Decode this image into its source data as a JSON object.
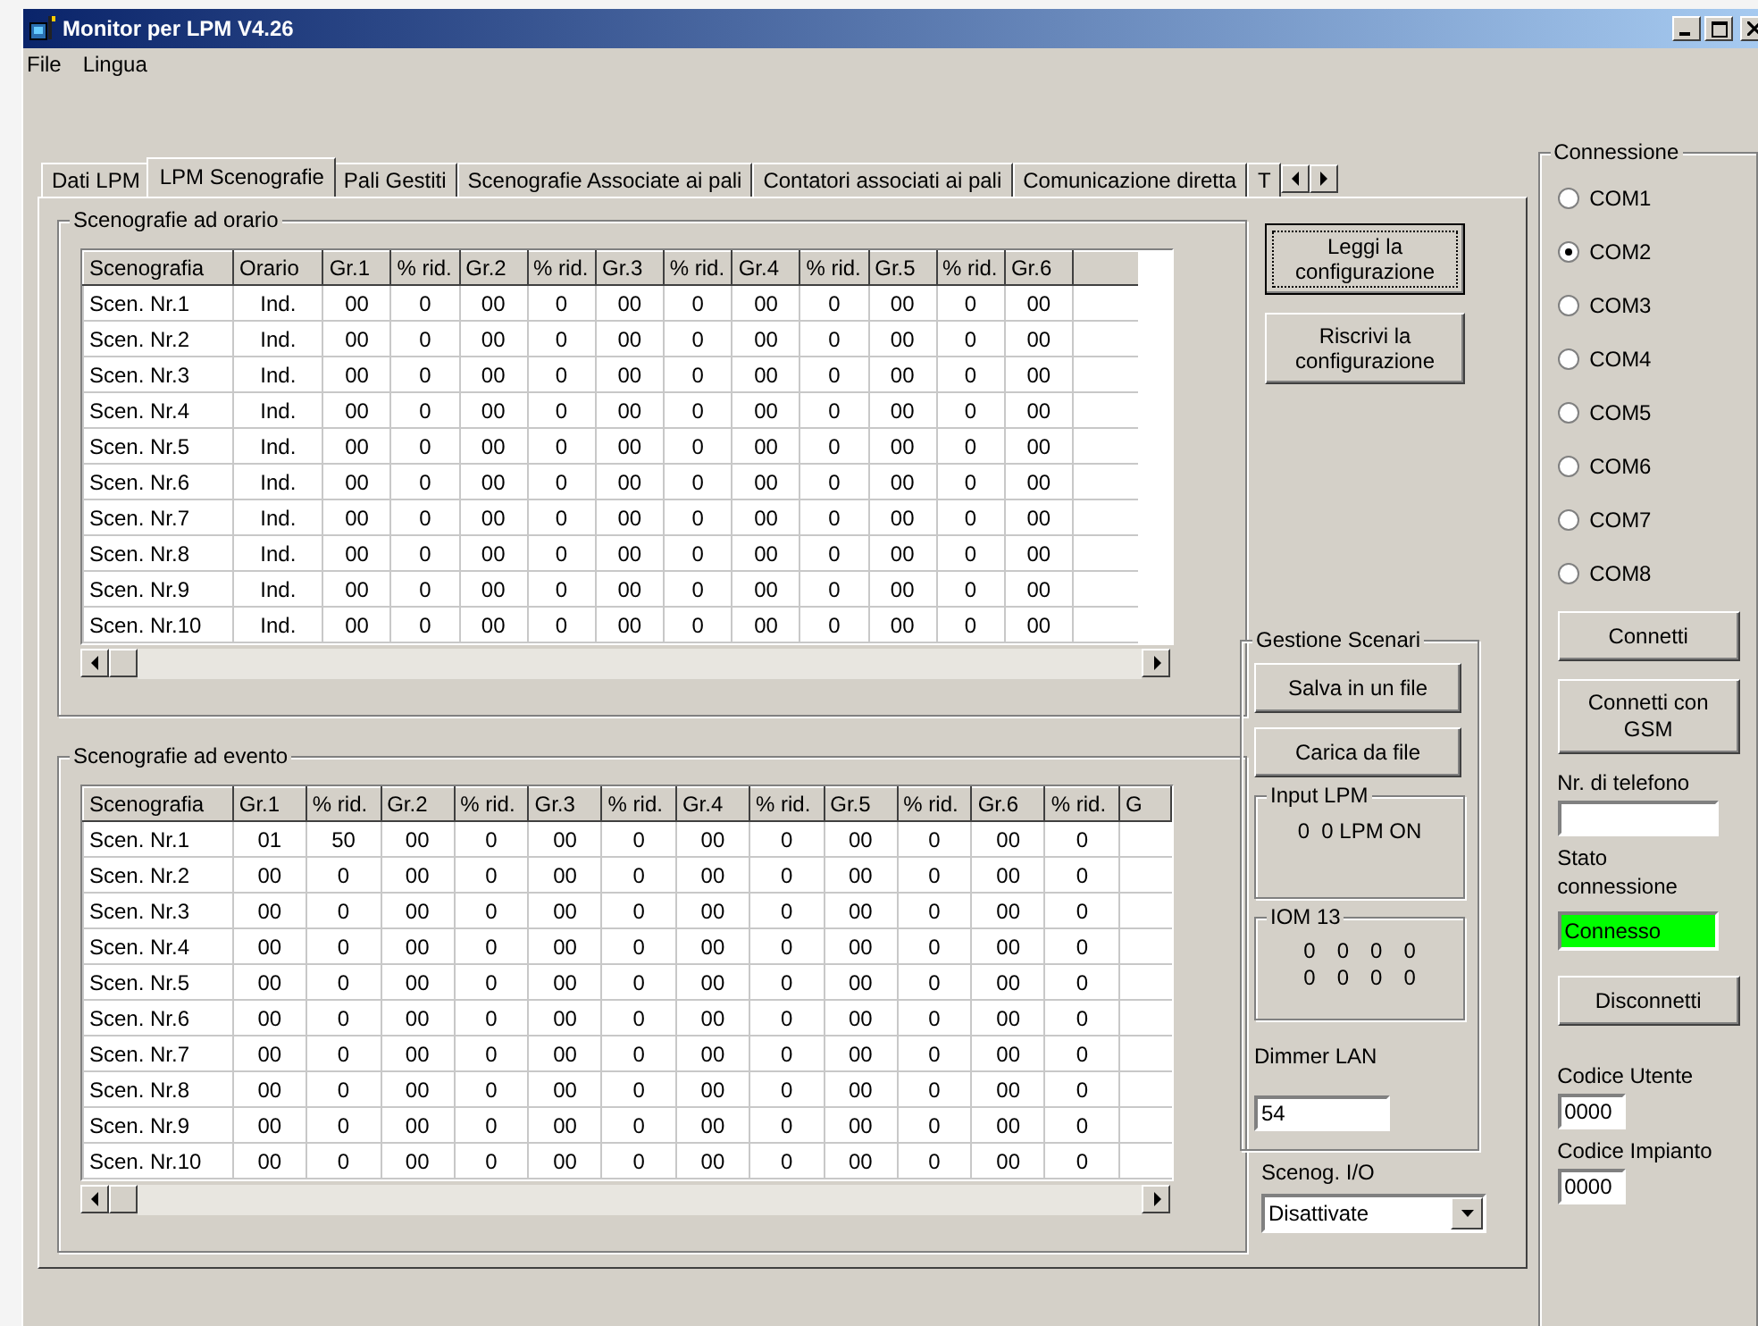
{
  "window": {
    "title": "Monitor per LPM V4.26"
  },
  "menu": [
    "File",
    "Lingua"
  ],
  "tabs": [
    {
      "label": "Dati LPM",
      "selected": false
    },
    {
      "label": "LPM Scenografie",
      "selected": true
    },
    {
      "label": "Pali Gestiti",
      "selected": false
    },
    {
      "label": "Scenografie Associate ai pali",
      "selected": false
    },
    {
      "label": "Contatori associati ai pali",
      "selected": false
    },
    {
      "label": "Comunicazione diretta",
      "selected": false
    },
    {
      "label": "T",
      "selected": false
    }
  ],
  "timed_scenes": {
    "title": "Scenografie ad orario",
    "columns": [
      "Scenografia",
      "Orario",
      "Gr.1",
      "% rid.",
      "Gr.2",
      "% rid.",
      "Gr.3",
      "% rid.",
      "Gr.4",
      "% rid.",
      "Gr.5",
      "% rid.",
      "Gr.6"
    ],
    "rows": [
      [
        "Scen. Nr.1",
        "Ind.",
        "00",
        "0",
        "00",
        "0",
        "00",
        "0",
        "00",
        "0",
        "00",
        "0",
        "00"
      ],
      [
        "Scen. Nr.2",
        "Ind.",
        "00",
        "0",
        "00",
        "0",
        "00",
        "0",
        "00",
        "0",
        "00",
        "0",
        "00"
      ],
      [
        "Scen. Nr.3",
        "Ind.",
        "00",
        "0",
        "00",
        "0",
        "00",
        "0",
        "00",
        "0",
        "00",
        "0",
        "00"
      ],
      [
        "Scen. Nr.4",
        "Ind.",
        "00",
        "0",
        "00",
        "0",
        "00",
        "0",
        "00",
        "0",
        "00",
        "0",
        "00"
      ],
      [
        "Scen. Nr.5",
        "Ind.",
        "00",
        "0",
        "00",
        "0",
        "00",
        "0",
        "00",
        "0",
        "00",
        "0",
        "00"
      ],
      [
        "Scen. Nr.6",
        "Ind.",
        "00",
        "0",
        "00",
        "0",
        "00",
        "0",
        "00",
        "0",
        "00",
        "0",
        "00"
      ],
      [
        "Scen. Nr.7",
        "Ind.",
        "00",
        "0",
        "00",
        "0",
        "00",
        "0",
        "00",
        "0",
        "00",
        "0",
        "00"
      ],
      [
        "Scen. Nr.8",
        "Ind.",
        "00",
        "0",
        "00",
        "0",
        "00",
        "0",
        "00",
        "0",
        "00",
        "0",
        "00"
      ],
      [
        "Scen. Nr.9",
        "Ind.",
        "00",
        "0",
        "00",
        "0",
        "00",
        "0",
        "00",
        "0",
        "00",
        "0",
        "00"
      ],
      [
        "Scen. Nr.10",
        "Ind.",
        "00",
        "0",
        "00",
        "0",
        "00",
        "0",
        "00",
        "0",
        "00",
        "0",
        "00"
      ]
    ]
  },
  "event_scenes": {
    "title": "Scenografie ad evento",
    "columns": [
      "Scenografia",
      "Gr.1",
      "% rid.",
      "Gr.2",
      "% rid.",
      "Gr.3",
      "% rid.",
      "Gr.4",
      "% rid.",
      "Gr.5",
      "% rid.",
      "Gr.6",
      "% rid.",
      "G"
    ],
    "rows": [
      [
        "Scen. Nr.1",
        "01",
        "50",
        "00",
        "0",
        "00",
        "0",
        "00",
        "0",
        "00",
        "0",
        "00",
        "0"
      ],
      [
        "Scen. Nr.2",
        "00",
        "0",
        "00",
        "0",
        "00",
        "0",
        "00",
        "0",
        "00",
        "0",
        "00",
        "0"
      ],
      [
        "Scen. Nr.3",
        "00",
        "0",
        "00",
        "0",
        "00",
        "0",
        "00",
        "0",
        "00",
        "0",
        "00",
        "0"
      ],
      [
        "Scen. Nr.4",
        "00",
        "0",
        "00",
        "0",
        "00",
        "0",
        "00",
        "0",
        "00",
        "0",
        "00",
        "0"
      ],
      [
        "Scen. Nr.5",
        "00",
        "0",
        "00",
        "0",
        "00",
        "0",
        "00",
        "0",
        "00",
        "0",
        "00",
        "0"
      ],
      [
        "Scen. Nr.6",
        "00",
        "0",
        "00",
        "0",
        "00",
        "0",
        "00",
        "0",
        "00",
        "0",
        "00",
        "0"
      ],
      [
        "Scen. Nr.7",
        "00",
        "0",
        "00",
        "0",
        "00",
        "0",
        "00",
        "0",
        "00",
        "0",
        "00",
        "0"
      ],
      [
        "Scen. Nr.8",
        "00",
        "0",
        "00",
        "0",
        "00",
        "0",
        "00",
        "0",
        "00",
        "0",
        "00",
        "0"
      ],
      [
        "Scen. Nr.9",
        "00",
        "0",
        "00",
        "0",
        "00",
        "0",
        "00",
        "0",
        "00",
        "0",
        "00",
        "0"
      ],
      [
        "Scen. Nr.10",
        "00",
        "0",
        "00",
        "0",
        "00",
        "0",
        "00",
        "0",
        "00",
        "0",
        "00",
        "0"
      ]
    ]
  },
  "config_buttons": [
    "Leggi la configurazione",
    "Riscrivi la configurazione"
  ],
  "scene_management": {
    "title": "Gestione Scenari",
    "buttons": [
      "Salva in un file",
      "Carica da file"
    ],
    "input_lpm": {
      "title": "Input LPM",
      "value": "0  0 LPM ON"
    },
    "iom": {
      "title": "IOM 13",
      "rows": [
        [
          "0",
          "0",
          "0",
          "0"
        ],
        [
          "0",
          "0",
          "0",
          "0"
        ]
      ]
    },
    "dimmer": {
      "label": "Dimmer LAN",
      "value": "54"
    }
  },
  "scene_io": {
    "label": "Scenog. I/O",
    "value": "Disattivate"
  },
  "connection": {
    "title": "Connessione",
    "ports": [
      {
        "label": "COM1",
        "selected": false
      },
      {
        "label": "COM2",
        "selected": true
      },
      {
        "label": "COM3",
        "selected": false
      },
      {
        "label": "COM4",
        "selected": false
      },
      {
        "label": "COM5",
        "selected": false
      },
      {
        "label": "COM6",
        "selected": false
      },
      {
        "label": "COM7",
        "selected": false
      },
      {
        "label": "COM8",
        "selected": false
      }
    ],
    "connect": "Connetti",
    "connect_gsm": "Connetti con GSM",
    "phone": {
      "label": "Nr. di telefono"
    },
    "status": {
      "label": "Stato connessione",
      "value": "Connesso",
      "connected": true
    },
    "disconnect": "Disconnetti",
    "user_code": {
      "label": "Codice Utente",
      "value": "0000"
    },
    "plant_code": {
      "label": "Codice Impianto",
      "value": "0000"
    }
  }
}
